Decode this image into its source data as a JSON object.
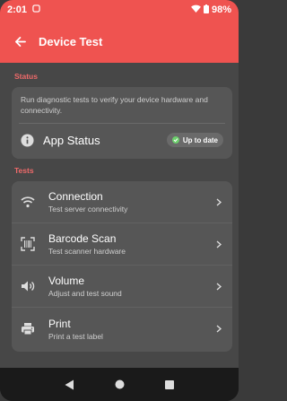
{
  "status_bar": {
    "time": "2:01",
    "battery": "98%"
  },
  "app_bar": {
    "title": "Device Test"
  },
  "status_section": {
    "label": "Status",
    "description": "Run diagnostic tests to verify your device hardware and connectivity.",
    "app_status_label": "App Status",
    "badge": "Up to date"
  },
  "tests_section": {
    "label": "Tests",
    "items": [
      {
        "title": "Connection",
        "subtitle": "Test server connectivity",
        "icon": "wifi-icon"
      },
      {
        "title": "Barcode Scan",
        "subtitle": "Test scanner hardware",
        "icon": "barcode-scan-icon"
      },
      {
        "title": "Volume",
        "subtitle": "Adjust and test sound",
        "icon": "volume-icon"
      },
      {
        "title": "Print",
        "subtitle": "Print a test label",
        "icon": "printer-icon"
      }
    ]
  },
  "colors": {
    "accent": "#ef5350",
    "background": "#474747",
    "card": "#565656",
    "success": "#6ccf6c"
  }
}
